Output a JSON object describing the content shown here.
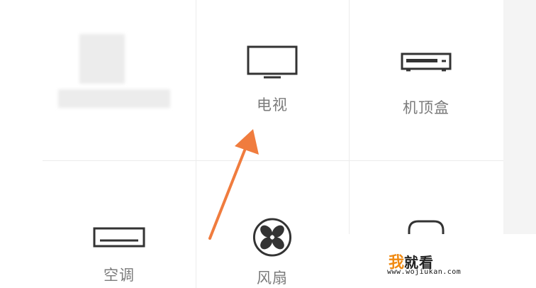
{
  "devices": [
    {
      "label": "电视",
      "icon": "tv-icon"
    },
    {
      "label": "机顶盒",
      "icon": "set-top-box-icon"
    },
    {
      "label": "空调",
      "icon": "air-conditioner-icon"
    },
    {
      "label": "风扇",
      "icon": "fan-icon"
    }
  ],
  "watermark": {
    "char1": "我",
    "rest": "就看",
    "url": "www.wojiukan.com"
  },
  "colors": {
    "arrow": "#f07c3e",
    "icon": "#333333",
    "label": "#7b7b7b",
    "brand": "#f08a12"
  }
}
